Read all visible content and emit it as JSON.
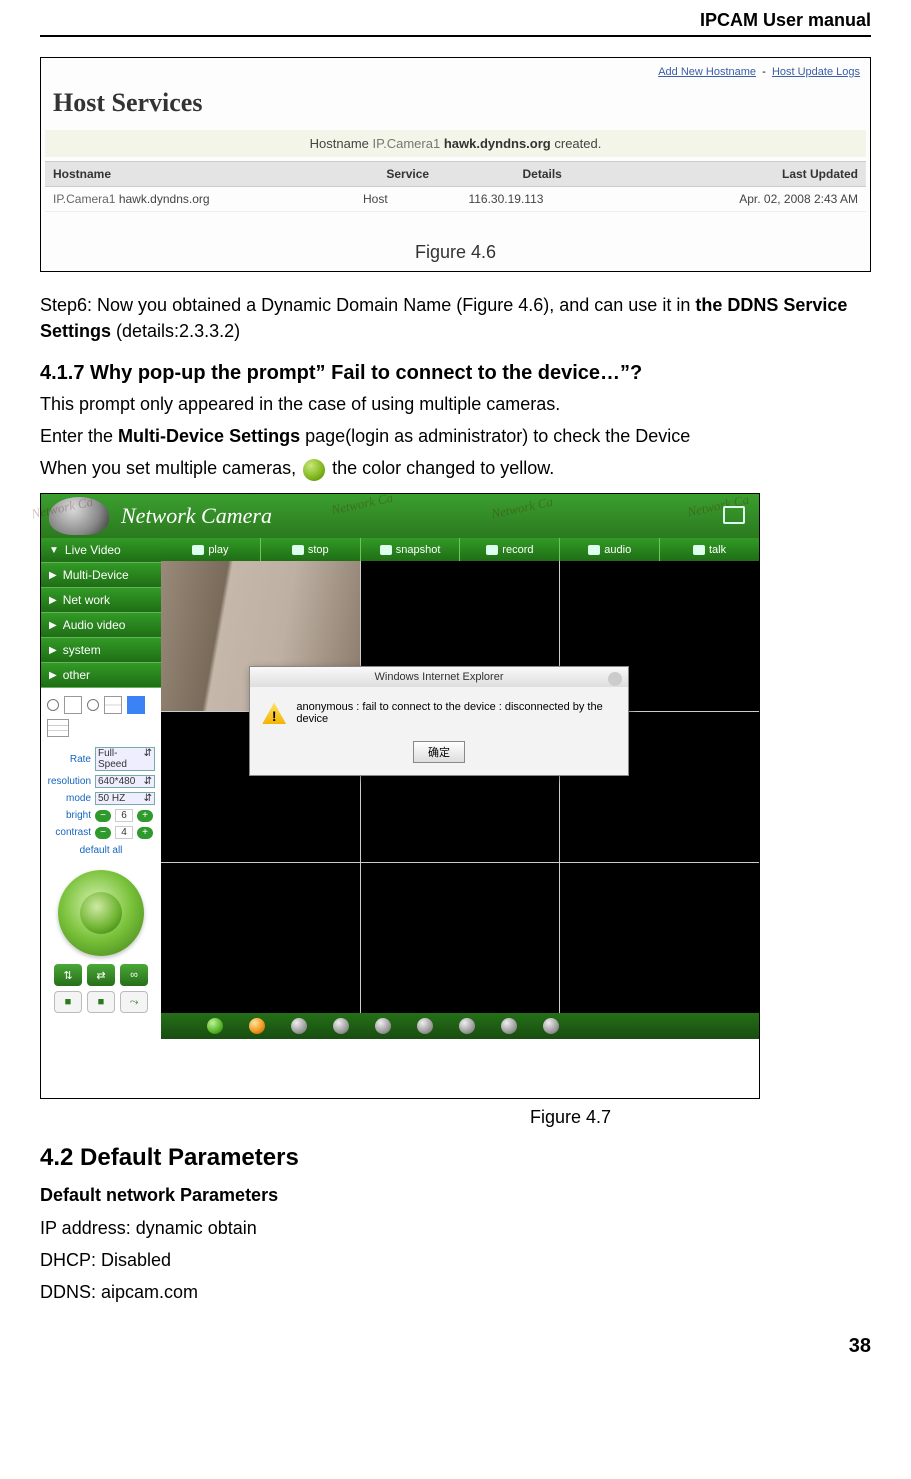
{
  "header": {
    "title": "IPCAM User manual"
  },
  "figure46": {
    "title": "Host Services",
    "topLinks": {
      "addNew": "Add New Hostname",
      "logs": "Host Update Logs"
    },
    "statusPrefix": "Hostname",
    "statusProduct": "IP.Camera1",
    "statusHost": "hawk.dyndns.org",
    "statusSuffix": "created.",
    "cols": {
      "hostname": "Hostname",
      "service": "Service",
      "details": "Details",
      "updated": "Last Updated"
    },
    "row": {
      "hostnamePrefix": "IP.Camera1",
      "hostname": "hawk.dyndns.org",
      "service": "Host",
      "details": "116.30.19.113",
      "updated": "Apr. 02, 2008 2:43 AM"
    },
    "caption": "Figure 4.6"
  },
  "step6": {
    "prefix": "Step6: Now you obtained a Dynamic Domain Name (Figure 4.6), and can use it in ",
    "bold": "the DDNS Service Settings",
    "suffix": " (details:2.3.3.2)"
  },
  "section417": {
    "title": "4.1.7 Why pop-up the prompt” Fail to connect to the device…”?",
    "line1": "This prompt only appeared in the case of using multiple cameras.",
    "line2a": "Enter the ",
    "line2bold": "Multi-Device Settings",
    "line2b": " page(login as administrator) to check the Device",
    "line3a": "When you set multiple cameras, ",
    "line3b": "the color changed to yellow."
  },
  "camera": {
    "title": "Network Camera",
    "watermark": "Network Ca",
    "nav": {
      "live": "Live Video",
      "multi": "Multi-Device",
      "net": "Net work",
      "av": "Audio video",
      "system": "system",
      "other": "other"
    },
    "toolbar": {
      "play": "play",
      "stop": "stop",
      "snapshot": "snapshot",
      "record": "record",
      "audio": "audio",
      "talk": "talk"
    },
    "controls": {
      "rateLabel": "Rate",
      "rateValue": "Full-Speed",
      "resLabel": "resolution",
      "resValue": "640*480",
      "modeLabel": "mode",
      "modeValue": "50 HZ",
      "brightLabel": "bright",
      "brightValue": "6",
      "contrastLabel": "contrast",
      "contrastValue": "4",
      "defaultAll": "default all"
    },
    "dialog": {
      "title": "Windows Internet Explorer",
      "message": "anonymous : fail to connect to the device : disconnected by the device",
      "button": "确定"
    }
  },
  "figure47": {
    "caption": "Figure 4.7"
  },
  "section42": {
    "title": "4.2 Default Parameters",
    "subtitle": "Default network Parameters",
    "ip": "IP address: dynamic obtain",
    "dhcp": "DHCP: Disabled",
    "ddns": "DDNS: aipcam.com"
  },
  "page": "38"
}
